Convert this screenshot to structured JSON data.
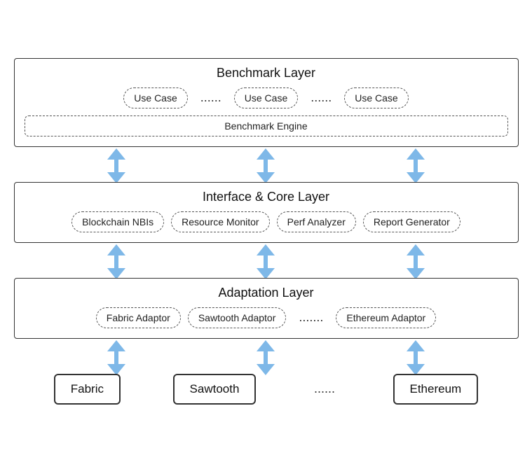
{
  "benchmark_layer": {
    "title": "Benchmark Layer",
    "use_cases": [
      "Use Case",
      "Use Case",
      "Use Case"
    ],
    "ellipsis": "......",
    "engine": "Benchmark Engine"
  },
  "interface_layer": {
    "title": "Interface & Core Layer",
    "items": [
      "Blockchain NBIs",
      "Resource Monitor",
      "Perf Analyzer",
      "Report Generator"
    ]
  },
  "adaptation_layer": {
    "title": "Adaptation Layer",
    "items": [
      "Fabric Adaptor",
      "Sawtooth Adaptor",
      "Ethereum Adaptor"
    ],
    "ellipsis": "......."
  },
  "blockchain_nodes": {
    "items": [
      "Fabric",
      "Sawtooth",
      "Ethereum"
    ],
    "ellipsis": "......"
  },
  "arrows": {
    "color": "#7eb8e8"
  }
}
